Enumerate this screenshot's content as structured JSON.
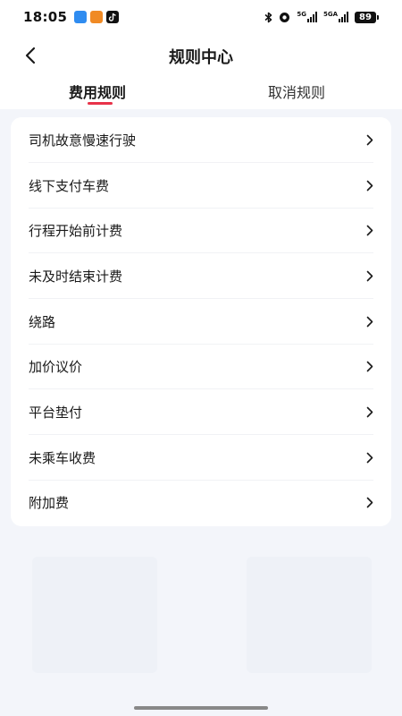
{
  "status_bar": {
    "time": "18:05",
    "network_1": "5G",
    "network_2": "5GA",
    "battery": "89",
    "app_icons": [
      "blue-app-icon",
      "orange-app-icon",
      "tiktok-icon"
    ]
  },
  "nav": {
    "title": "规则中心",
    "back_icon": "chevron-left-icon"
  },
  "tabs": [
    {
      "label": "费用规则",
      "active": true
    },
    {
      "label": "取消规则",
      "active": false
    }
  ],
  "colors": {
    "accent": "#e8334a",
    "page_bg": "#f3f5fa",
    "card_bg": "#ffffff"
  },
  "rules": [
    {
      "label": "司机故意慢速行驶"
    },
    {
      "label": "线下支付车费"
    },
    {
      "label": "行程开始前计费"
    },
    {
      "label": "未及时结束计费"
    },
    {
      "label": "绕路"
    },
    {
      "label": "加价议价"
    },
    {
      "label": "平台垫付"
    },
    {
      "label": "未乘车收费"
    },
    {
      "label": "附加费"
    }
  ]
}
